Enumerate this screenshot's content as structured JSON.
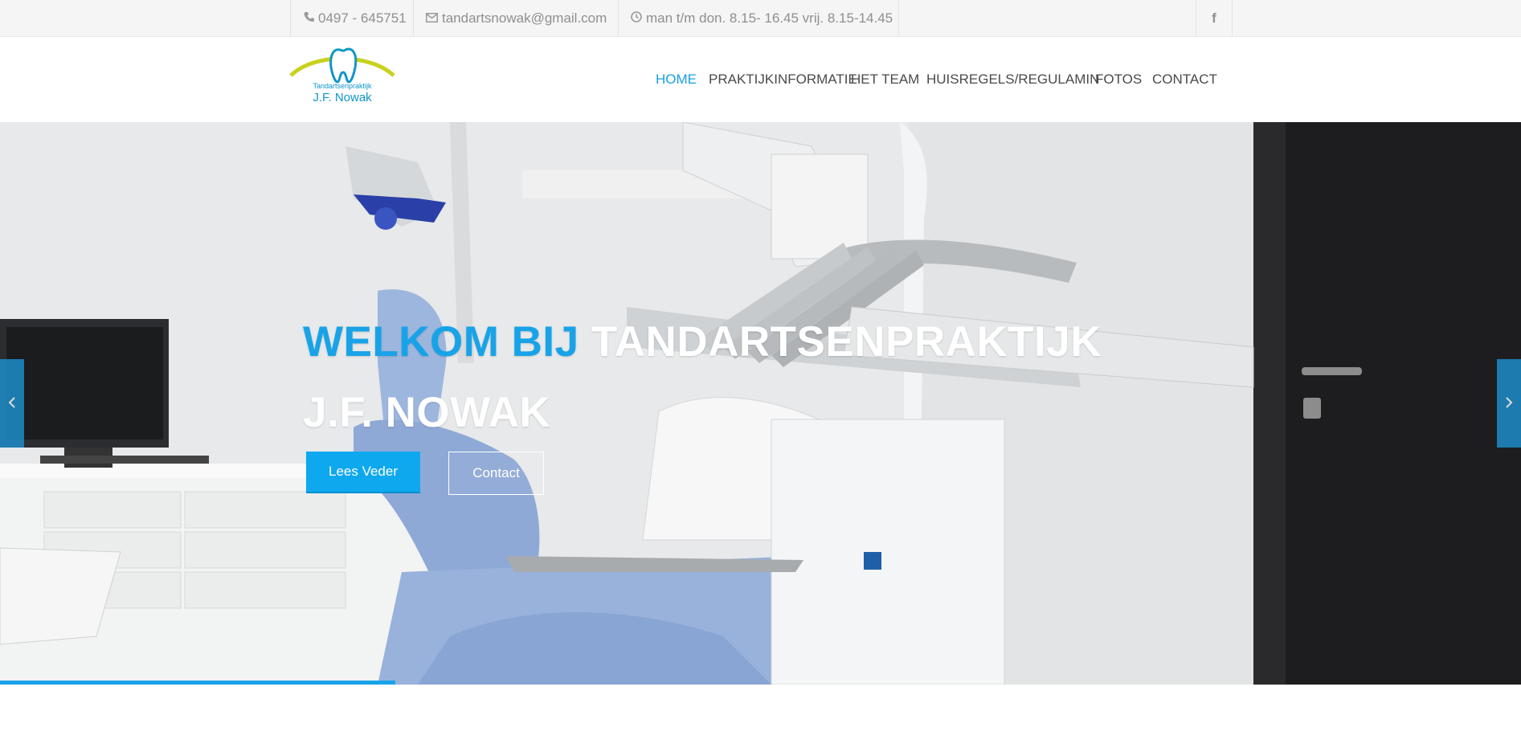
{
  "topbar": {
    "phone": "0497 - 645751",
    "email": "tandartsnowak@gmail.com",
    "hours": "man t/m don. 8.15- 16.45 vrij. 8.15-14.45",
    "facebook_icon": "f"
  },
  "logo": {
    "line1": "Tandartsenpraktijk",
    "line2": "J.F. Nowak"
  },
  "nav": {
    "items": [
      {
        "label": "HOME"
      },
      {
        "label": "PRAKTIJKINFORMATIE"
      },
      {
        "label": "HET TEAM"
      },
      {
        "label": "HUISREGELS/REGULAMIN"
      },
      {
        "label": "FOTOS"
      },
      {
        "label": "CONTACT"
      }
    ],
    "active_color": "#18a0e0"
  },
  "hero": {
    "title_blue": "WELKOM BIJ",
    "title_white_1": "TANDARTSENPRAKTIJK",
    "title_white_2": "J.F. NOWAK",
    "btn_primary": "Lees Veder",
    "btn_secondary": "Contact",
    "accent": "#18a3e8",
    "slide_progress": 0.26
  }
}
